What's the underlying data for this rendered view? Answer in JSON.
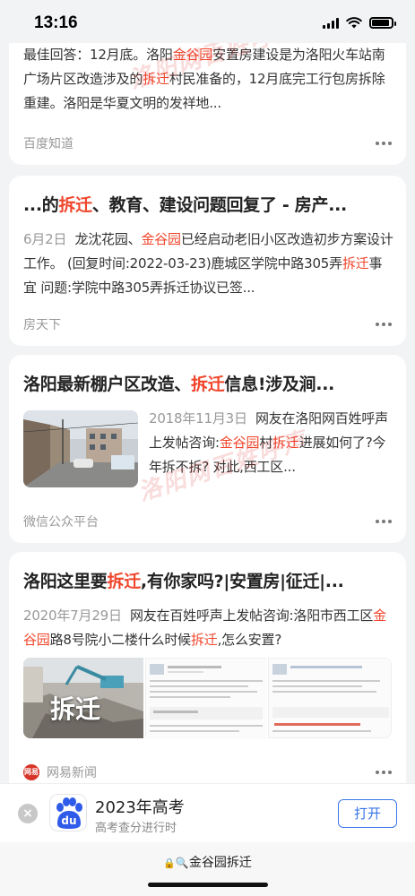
{
  "status_bar": {
    "time": "13:16"
  },
  "cards": [
    {
      "abstract_parts": [
        "最佳回答：12月底。洛阳",
        "金谷园",
        "安置房建设是为洛阳火车站南广场片区改造涉及的",
        "拆迁",
        "村民准备的，12月底完工行包房拆除重建。洛阳是华夏文明的发祥地..."
      ],
      "source": "百度知道"
    },
    {
      "title_parts": [
        "...的",
        "拆迁",
        "、教育、建设问题回复了 - 房产..."
      ],
      "date": "6月2日",
      "abstract_parts": [
        "龙沈花园、",
        "金谷园",
        "已经启动老旧小区改造初步方案设计工作。 (回复时间:2022-03-23)鹿城区学院中路305弄",
        "拆迁",
        "事宜 问题:学院中路305弄拆迁协议已签..."
      ],
      "source": "房天下"
    },
    {
      "title_parts": [
        "洛阳最新棚户区改造、",
        "拆迁",
        "信息!涉及涧..."
      ],
      "date": "2018年11月3日",
      "abstract_parts": [
        "网友在洛阳网百姓呼声上发帖咨询:",
        "金谷园",
        "村",
        "拆迁",
        "进展如何了?今年拆不拆? 对此,西工区..."
      ],
      "source": "微信公众平台"
    },
    {
      "title_parts": [
        "洛阳这里要",
        "拆迁",
        ",有你家吗?|安置房|征迁|..."
      ],
      "date": "2020年7月29日",
      "abstract_parts": [
        "网友在百姓呼声上发帖咨询:洛阳市西工区",
        "金谷园",
        "路8号院小二楼什么时候",
        "拆迁",
        ",怎么安置?"
      ],
      "image_caption": "拆迁",
      "source": "网易新闻",
      "source_badge": "网易"
    }
  ],
  "banner": {
    "title": "2023年高考",
    "subtitle": "高考查分进行时",
    "open_label": "打开",
    "logo_text": "du"
  },
  "address_bar": {
    "query": "金谷园拆迁"
  },
  "watermark": {
    "text": "洛阳网百姓呼声"
  },
  "colors": {
    "highlight": "#f0452b",
    "accent": "#3976e8"
  }
}
